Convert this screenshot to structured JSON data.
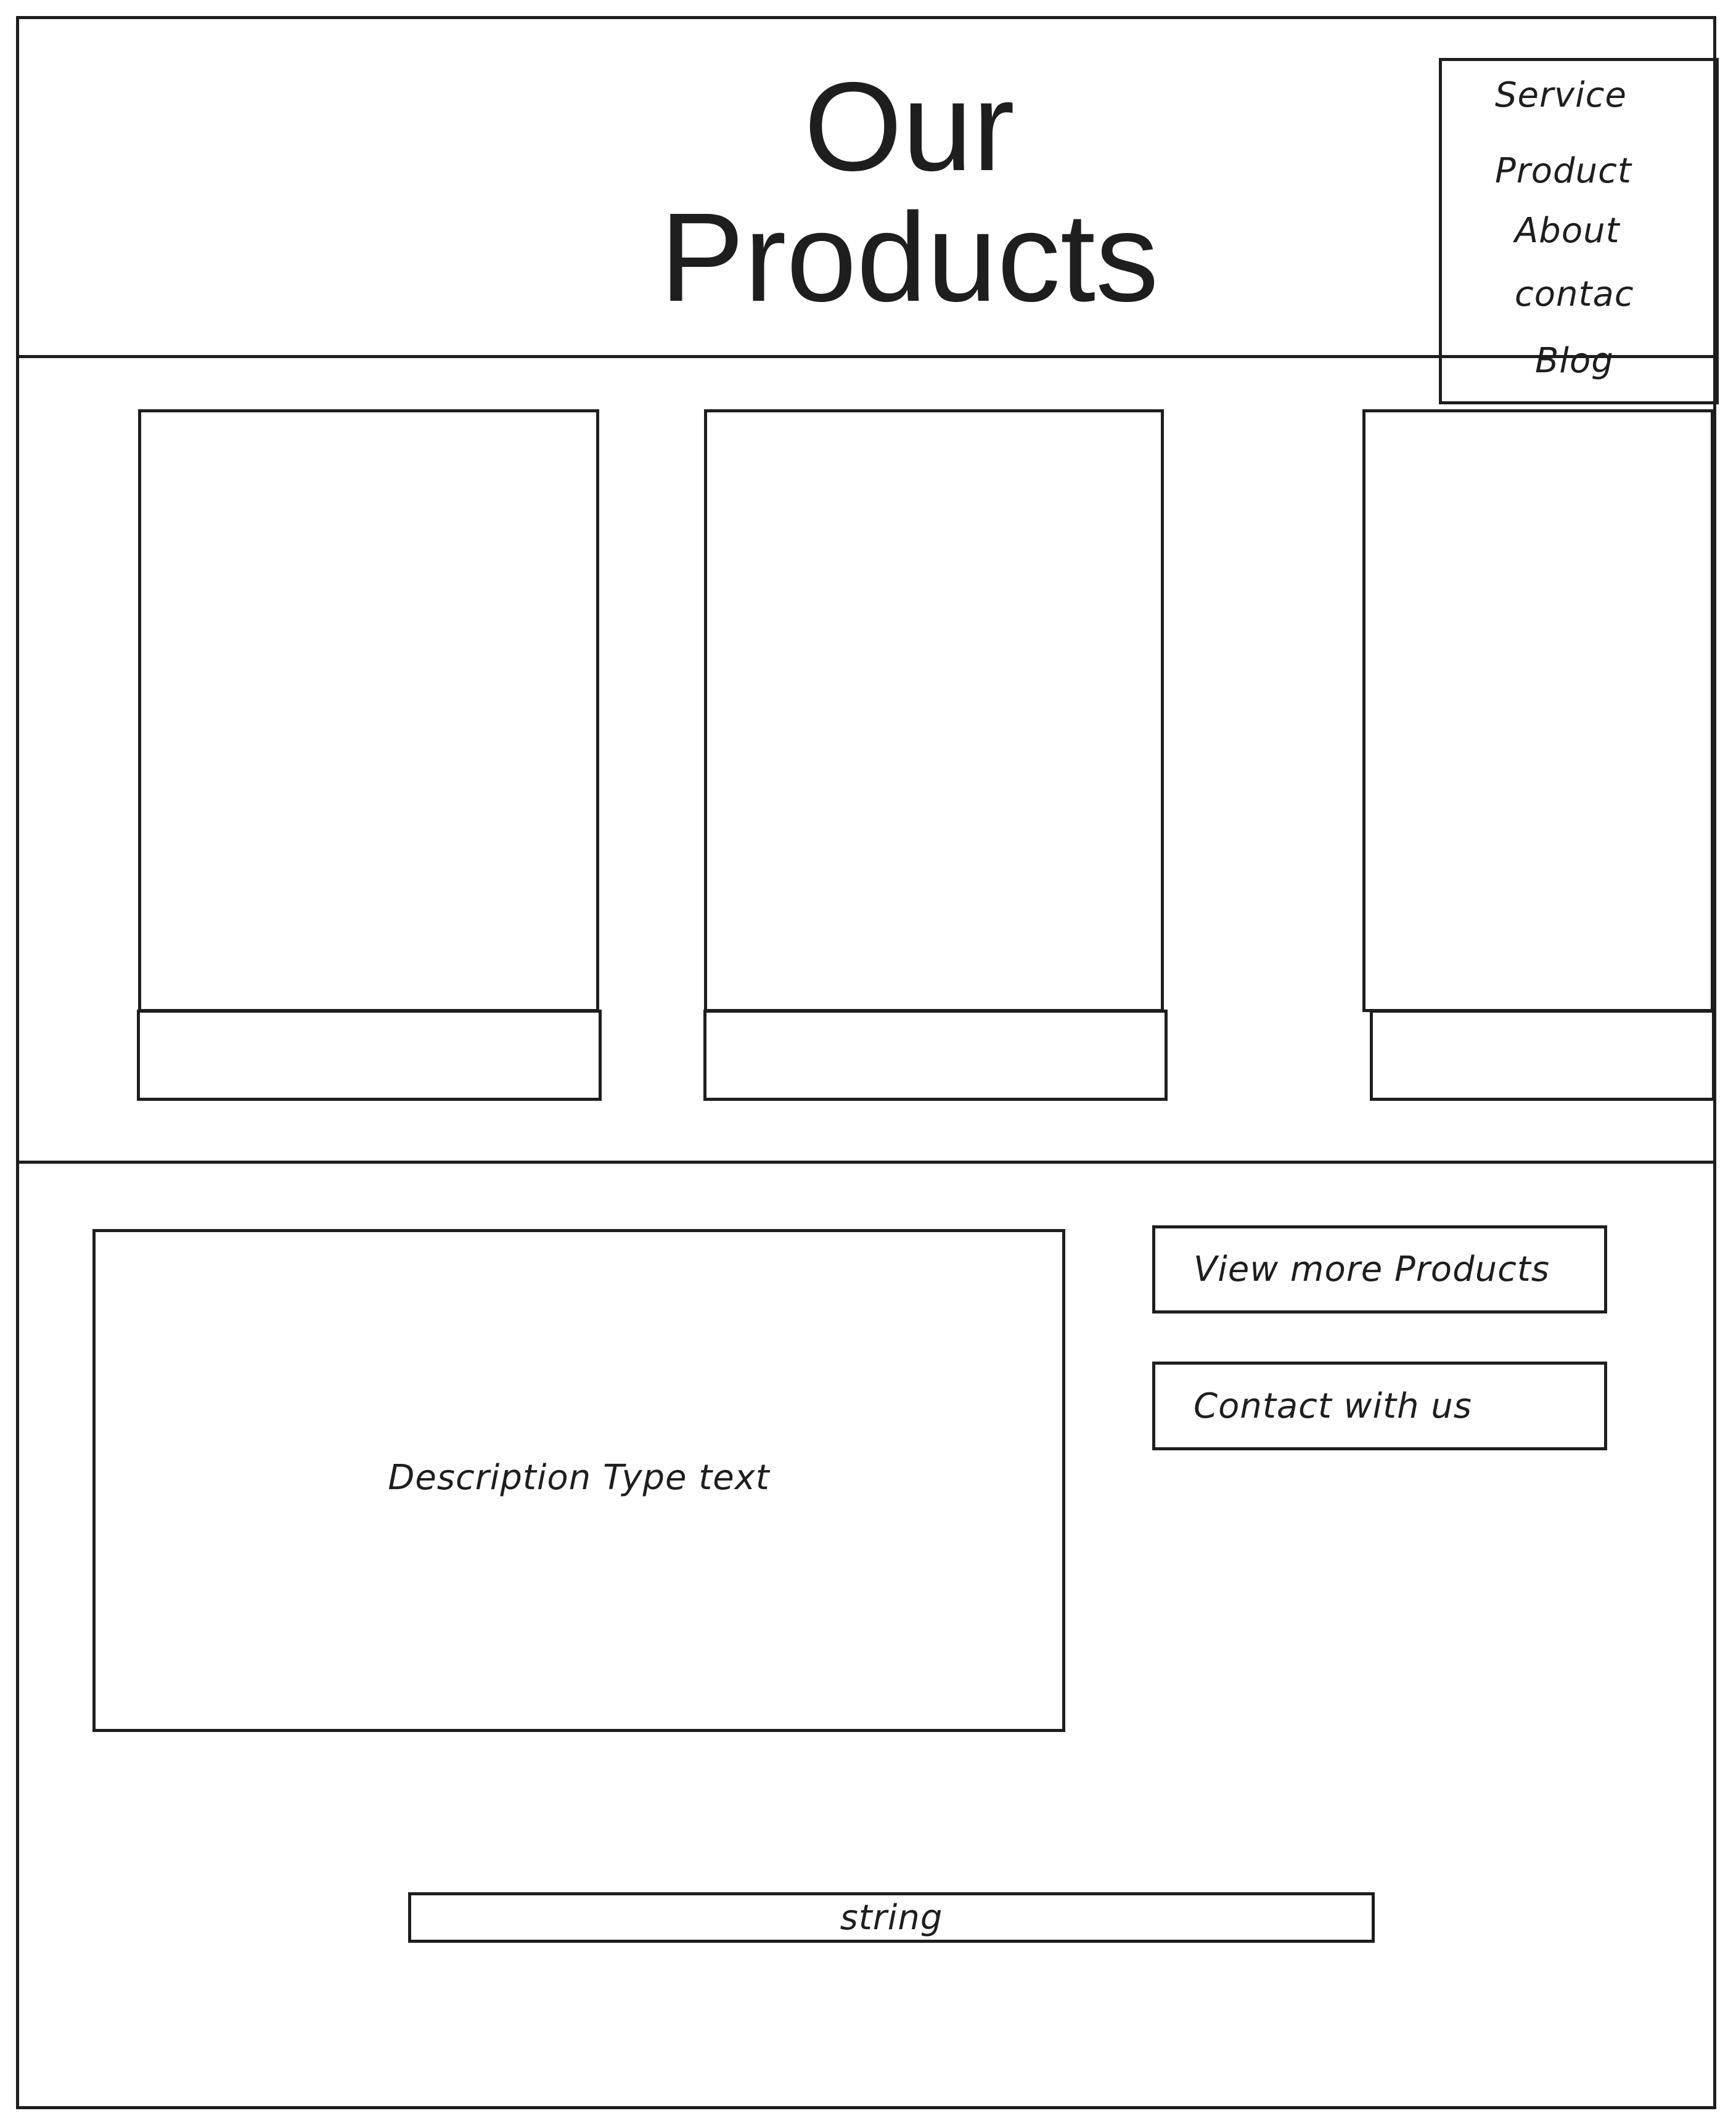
{
  "header": {
    "title_line1": "Our",
    "title_line2": "Products"
  },
  "nav": {
    "items": [
      {
        "label": "Service"
      },
      {
        "label": "Product"
      },
      {
        "label": "About"
      },
      {
        "label": "contac"
      },
      {
        "label": "Blog"
      }
    ]
  },
  "products": {
    "cards": [
      {
        "name": "product-card-1"
      },
      {
        "name": "product-card-2"
      },
      {
        "name": "product-card-3"
      }
    ]
  },
  "description": {
    "text": "Description Type text"
  },
  "actions": {
    "view_more_label": "View more Products",
    "contact_label": "Contact with us"
  },
  "footer": {
    "string_label": "string"
  }
}
